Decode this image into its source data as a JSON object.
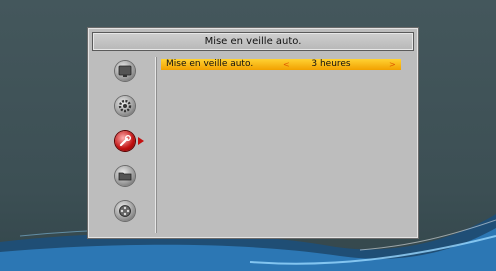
{
  "dialog": {
    "title": "Mise en veille auto."
  },
  "sidebar": {
    "items": [
      {
        "icon": "tv-icon",
        "active": false
      },
      {
        "icon": "gear-icon",
        "active": false
      },
      {
        "icon": "wrench-icon",
        "active": true
      },
      {
        "icon": "folder-icon",
        "active": false
      },
      {
        "icon": "film-reel-icon",
        "active": false
      }
    ]
  },
  "setting": {
    "label": "Mise en veille auto.",
    "value": "3 heures",
    "arrow_left": "<",
    "arrow_right": ">"
  },
  "colors": {
    "highlight": "#f7b500",
    "panel": "#bdbdbd",
    "active_icon": "#c41010",
    "background": "#3d5055"
  }
}
